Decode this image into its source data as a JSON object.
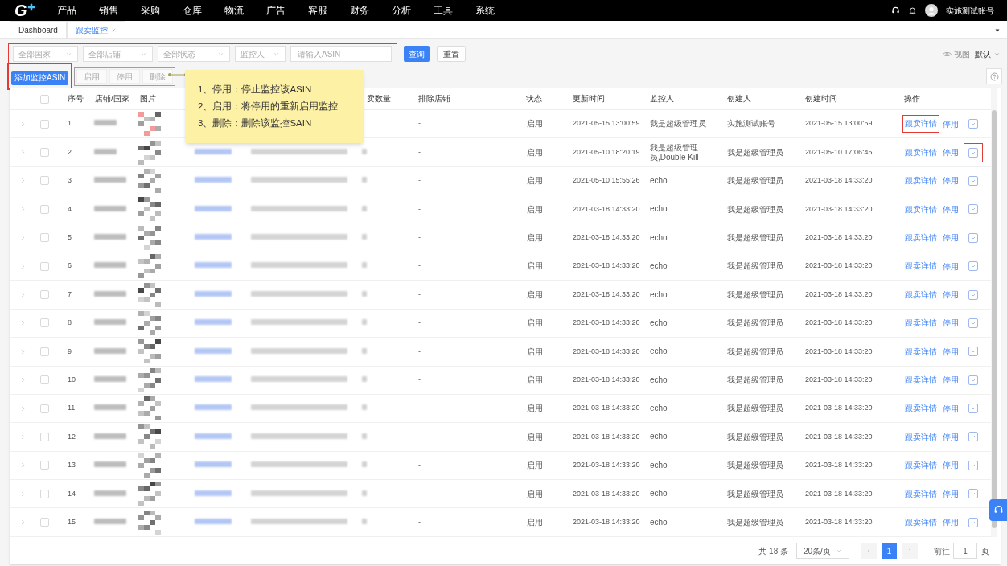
{
  "nav": {
    "logo_text": "G",
    "menu": [
      "产品",
      "销售",
      "采购",
      "仓库",
      "物流",
      "广告",
      "客服",
      "财务",
      "分析",
      "工具",
      "系统"
    ],
    "user": "实施测试账号"
  },
  "tabs": [
    {
      "label": "Dashboard",
      "selected": false,
      "closable": false
    },
    {
      "label": "跟卖监控",
      "selected": true,
      "closable": true
    }
  ],
  "filters": {
    "marked": true,
    "selects": [
      {
        "placeholder": "全部国家"
      },
      {
        "placeholder": "全部店铺"
      },
      {
        "placeholder": "全部状态"
      },
      {
        "placeholder": "监控人"
      }
    ],
    "asin_input": {
      "placeholder": "请输入ASIN"
    }
  },
  "search_button": "查询",
  "reset_button": "重置",
  "view": {
    "label": "视图",
    "value": "默认"
  },
  "add_button": {
    "label": "添加监控ASIN",
    "marked": true
  },
  "batch_actions": {
    "marked": true,
    "buttons": [
      "启用",
      "停用",
      "删除"
    ]
  },
  "tooltip": {
    "lines": [
      "1、停用：停止监控该ASIN",
      "2、启用：将停用的重新启用监控",
      "3、删除：删除该监控SAIN"
    ]
  },
  "table": {
    "header_checked": false,
    "columns": [
      "序号",
      "店铺/国家",
      "图片",
      "卖数量",
      "排除店铺",
      "状态",
      "更新时间",
      "监控人",
      "创建人",
      "创建时间",
      "操作"
    ],
    "rows": [
      {
        "expanded": false,
        "checked": false,
        "index": "1",
        "excluded": "-",
        "status": "启用",
        "updated": "2021-05-15 13:00:59",
        "monitor": "我是超级管理员",
        "creator": "实施测试账号",
        "created": "2021-05-15 13:00:59",
        "detail": "跟卖详情",
        "disable": "停用",
        "detail_marked": true,
        "menu_marked": false
      },
      {
        "expanded": false,
        "checked": false,
        "index": "2",
        "excluded": "-",
        "status": "启用",
        "updated": "2021-05-10 18:20:19",
        "monitor": "我是超级管理员,Double Kill",
        "creator": "我是超级管理员",
        "created": "2021-05-10 17:06:45",
        "detail": "跟卖详情",
        "disable": "停用",
        "detail_marked": false,
        "menu_marked": true
      },
      {
        "expanded": false,
        "checked": false,
        "index": "3",
        "excluded": "-",
        "status": "启用",
        "updated": "2021-05-10 15:55:26",
        "monitor": "echo",
        "creator": "我是超级管理员",
        "created": "2021-03-18 14:33:20",
        "detail": "跟卖详情",
        "disable": "停用",
        "detail_marked": false,
        "menu_marked": false
      },
      {
        "expanded": false,
        "checked": false,
        "index": "4",
        "excluded": "-",
        "status": "启用",
        "updated": "2021-03-18 14:33:20",
        "monitor": "echo",
        "creator": "我是超级管理员",
        "created": "2021-03-18 14:33:20",
        "detail": "跟卖详情",
        "disable": "停用",
        "detail_marked": false,
        "menu_marked": false
      },
      {
        "expanded": false,
        "checked": false,
        "index": "5",
        "excluded": "-",
        "status": "启用",
        "updated": "2021-03-18 14:33:20",
        "monitor": "echo",
        "creator": "我是超级管理员",
        "created": "2021-03-18 14:33:20",
        "detail": "跟卖详情",
        "disable": "停用",
        "detail_marked": false,
        "menu_marked": false
      },
      {
        "expanded": false,
        "checked": false,
        "index": "6",
        "excluded": "-",
        "status": "启用",
        "updated": "2021-03-18 14:33:20",
        "monitor": "echo",
        "creator": "我是超级管理员",
        "created": "2021-03-18 14:33:20",
        "detail": "跟卖详情",
        "disable": "停用",
        "detail_marked": false,
        "menu_marked": false
      },
      {
        "expanded": false,
        "checked": false,
        "index": "7",
        "excluded": "-",
        "status": "启用",
        "updated": "2021-03-18 14:33:20",
        "monitor": "echo",
        "creator": "我是超级管理员",
        "created": "2021-03-18 14:33:20",
        "detail": "跟卖详情",
        "disable": "停用",
        "detail_marked": false,
        "menu_marked": false
      },
      {
        "expanded": false,
        "checked": false,
        "index": "8",
        "excluded": "-",
        "status": "启用",
        "updated": "2021-03-18 14:33:20",
        "monitor": "echo",
        "creator": "我是超级管理员",
        "created": "2021-03-18 14:33:20",
        "detail": "跟卖详情",
        "disable": "停用",
        "detail_marked": false,
        "menu_marked": false
      },
      {
        "expanded": false,
        "checked": false,
        "index": "9",
        "excluded": "-",
        "status": "启用",
        "updated": "2021-03-18 14:33:20",
        "monitor": "echo",
        "creator": "我是超级管理员",
        "created": "2021-03-18 14:33:20",
        "detail": "跟卖详情",
        "disable": "停用",
        "detail_marked": false,
        "menu_marked": false
      },
      {
        "expanded": false,
        "checked": false,
        "index": "10",
        "excluded": "-",
        "status": "启用",
        "updated": "2021-03-18 14:33:20",
        "monitor": "echo",
        "creator": "我是超级管理员",
        "created": "2021-03-18 14:33:20",
        "detail": "跟卖详情",
        "disable": "停用",
        "detail_marked": false,
        "menu_marked": false
      },
      {
        "expanded": false,
        "checked": false,
        "index": "11",
        "excluded": "-",
        "status": "启用",
        "updated": "2021-03-18 14:33:20",
        "monitor": "echo",
        "creator": "我是超级管理员",
        "created": "2021-03-18 14:33:20",
        "detail": "跟卖详情",
        "disable": "停用",
        "detail_marked": false,
        "menu_marked": false
      },
      {
        "expanded": false,
        "checked": false,
        "index": "12",
        "excluded": "-",
        "status": "启用",
        "updated": "2021-03-18 14:33:20",
        "monitor": "echo",
        "creator": "我是超级管理员",
        "created": "2021-03-18 14:33:20",
        "detail": "跟卖详情",
        "disable": "停用",
        "detail_marked": false,
        "menu_marked": false
      },
      {
        "expanded": false,
        "checked": false,
        "index": "13",
        "excluded": "-",
        "status": "启用",
        "updated": "2021-03-18 14:33:20",
        "monitor": "echo",
        "creator": "我是超级管理员",
        "created": "2021-03-18 14:33:20",
        "detail": "跟卖详情",
        "disable": "停用",
        "detail_marked": false,
        "menu_marked": false
      },
      {
        "expanded": false,
        "checked": false,
        "index": "14",
        "excluded": "-",
        "status": "启用",
        "updated": "2021-03-18 14:33:20",
        "monitor": "echo",
        "creator": "我是超级管理员",
        "created": "2021-03-18 14:33:20",
        "detail": "跟卖详情",
        "disable": "停用",
        "detail_marked": false,
        "menu_marked": false
      },
      {
        "expanded": false,
        "checked": false,
        "index": "15",
        "excluded": "-",
        "status": "启用",
        "updated": "2021-03-18 14:33:20",
        "monitor": "echo",
        "creator": "我是超级管理员",
        "created": "2021-03-18 14:33:20",
        "detail": "跟卖详情",
        "disable": "停用",
        "detail_marked": false,
        "menu_marked": false
      }
    ]
  },
  "pagination": {
    "total": "共 18 条",
    "page_size": "20条/页",
    "pages": [
      {
        "label": "1",
        "selected": true
      }
    ],
    "goto_label": "前往",
    "goto_value": "1",
    "goto_suffix": "页"
  }
}
